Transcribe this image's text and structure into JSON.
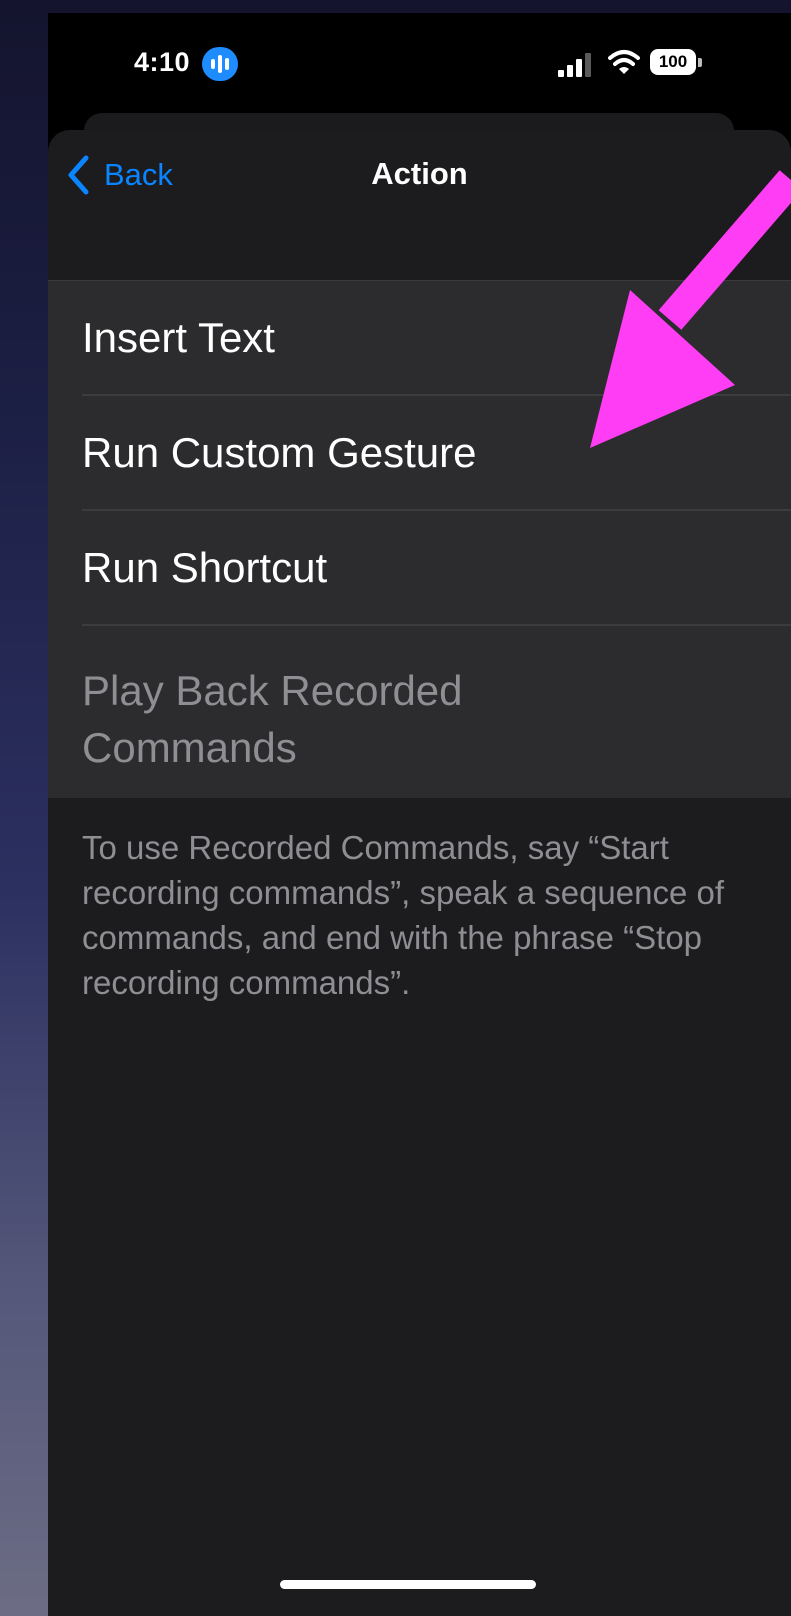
{
  "status_bar": {
    "time": "4:10",
    "battery": "100",
    "icons": [
      "live-activity-icon",
      "cellular-signal-icon",
      "wifi-icon",
      "battery-icon"
    ]
  },
  "nav": {
    "back_label": "Back",
    "title": "Action"
  },
  "options": [
    {
      "label": "Insert Text"
    },
    {
      "label": "Run Custom Gesture"
    },
    {
      "label": "Run Shortcut"
    },
    {
      "label": "Play Back Recorded Commands"
    }
  ],
  "footer_note": "To use Recorded Commands, say “Start recording commands”, speak a sequence of commands, and end with the phrase “Stop recording commands”.",
  "colors": {
    "accent": "#0a84ff",
    "annotation_arrow": "#ff3df4",
    "sheet_background": "#1c1c1e",
    "list_background": "#2c2c2e"
  }
}
